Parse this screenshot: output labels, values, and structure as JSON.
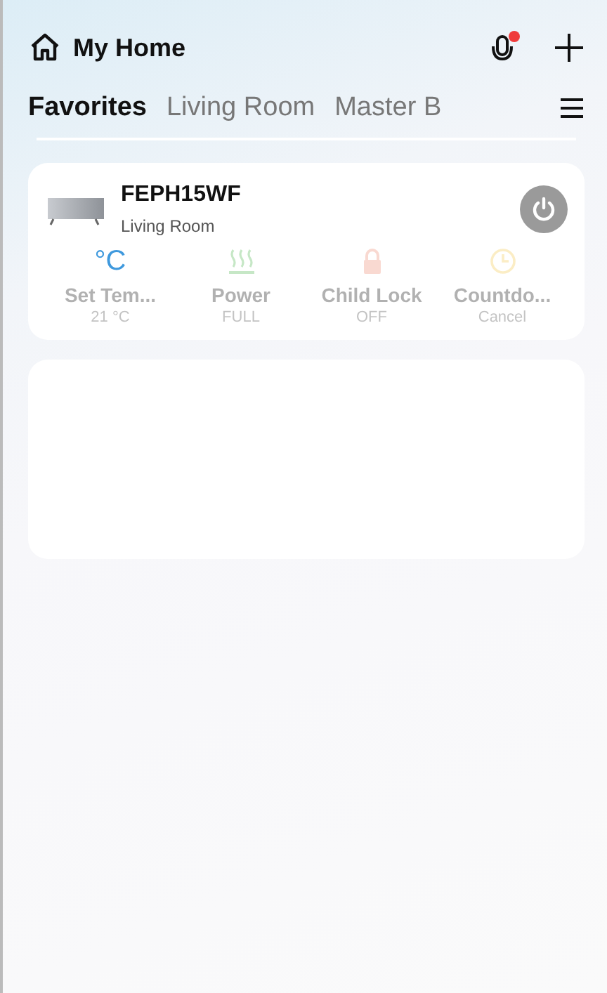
{
  "header": {
    "title": "My Home",
    "mic_notification": true
  },
  "tabs": [
    {
      "label": "Favorites",
      "selected": true
    },
    {
      "label": "Living Room",
      "selected": false
    },
    {
      "label": "Master B",
      "selected": false
    }
  ],
  "devices": [
    {
      "name": "FEPH15WF",
      "room": "Living Room",
      "on": false,
      "controls": [
        {
          "kind": "temperature",
          "symbol": "°C",
          "label": "Set Tem...",
          "value": "21 °C"
        },
        {
          "kind": "heat",
          "label": "Power",
          "value": "FULL"
        },
        {
          "kind": "lock",
          "label": "Child Lock",
          "value": "OFF"
        },
        {
          "kind": "timer",
          "label": "Countdo...",
          "value": "Cancel"
        }
      ]
    }
  ]
}
